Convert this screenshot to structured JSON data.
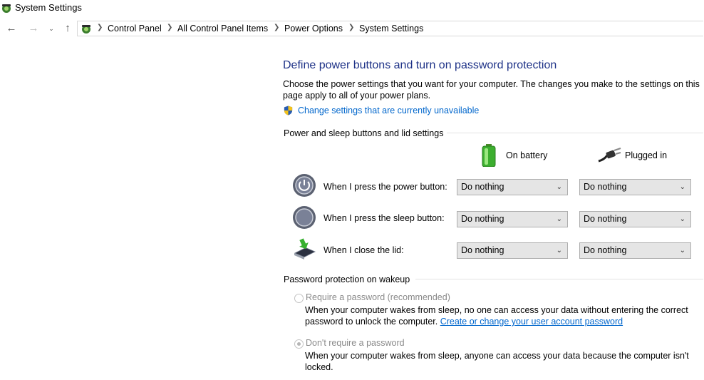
{
  "window": {
    "title": "System Settings"
  },
  "breadcrumb": [
    "Control Panel",
    "All Control Panel Items",
    "Power Options",
    "System Settings"
  ],
  "page": {
    "heading": "Define power buttons and turn on password protection",
    "description": "Choose the power settings that you want for your computer. The changes you make to the settings on this page apply to all of your power plans.",
    "change_link": "Change settings that are currently unavailable"
  },
  "buttons_group": {
    "title": "Power and sleep buttons and lid settings",
    "col_battery": "On battery",
    "col_plugged": "Plugged in",
    "rows": [
      {
        "label": "When I press the power button:",
        "battery": "Do nothing",
        "plugged": "Do nothing"
      },
      {
        "label": "When I press the sleep button:",
        "battery": "Do nothing",
        "plugged": "Do nothing"
      },
      {
        "label": "When I close the lid:",
        "battery": "Do nothing",
        "plugged": "Do nothing"
      }
    ]
  },
  "password_group": {
    "title": "Password protection on wakeup",
    "require_label": "Require a password (recommended)",
    "require_desc": "When your computer wakes from sleep, no one can access your data without entering the correct password to unlock the computer.",
    "require_link": "Create or change your user account password",
    "norequire_label": "Don't require a password",
    "norequire_desc": "When your computer wakes from sleep, anyone can access your data because the computer isn't locked.",
    "selected": "norequire"
  },
  "colors": {
    "heading": "#1e3287",
    "link": "#0066cc"
  }
}
